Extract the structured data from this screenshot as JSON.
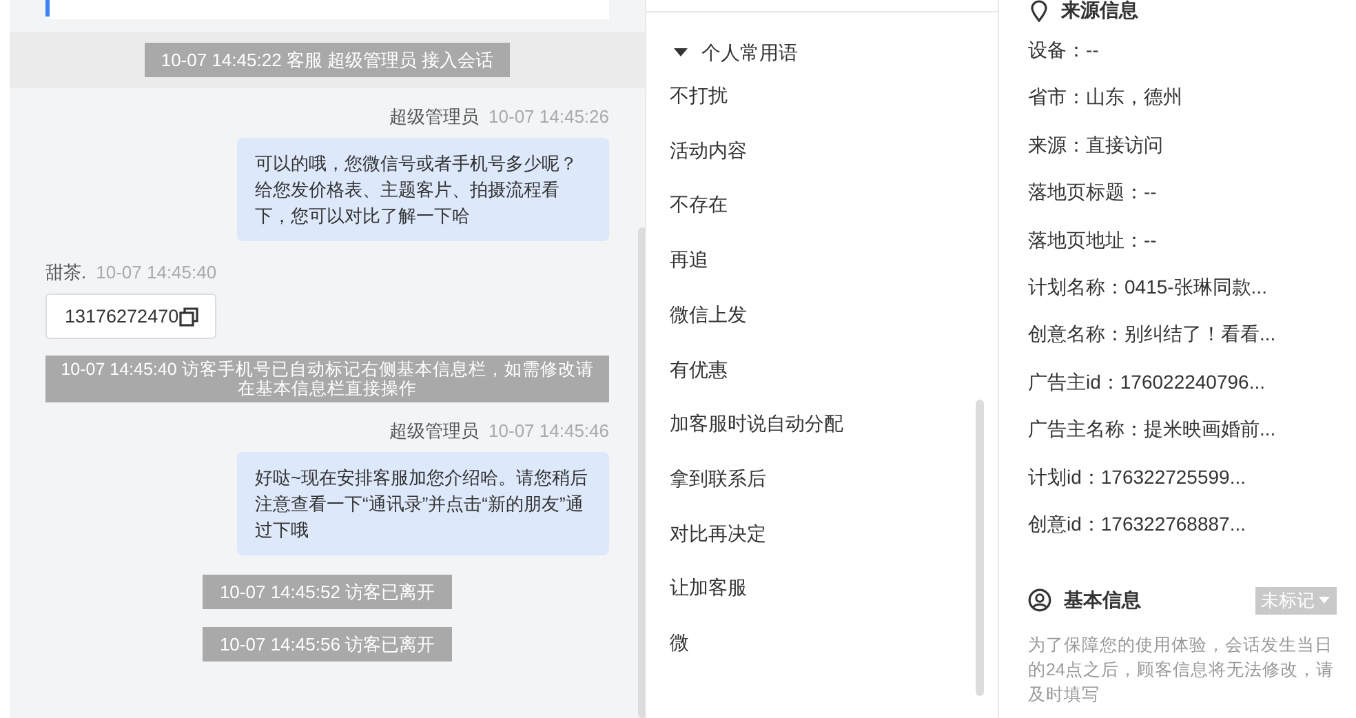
{
  "chat": {
    "messages": [
      {
        "kind": "system_band",
        "text": "10-07 14:45:22 客服 超级管理员 接入会话"
      },
      {
        "kind": "agent",
        "sender": "超级管理员",
        "time": "10-07 14:45:26",
        "text": "可以的哦，您微信号或者手机号多少呢？给您发价格表、主题客片、拍摄流程看下，您可以对比了解一下哈"
      },
      {
        "kind": "visitor",
        "sender": "甜茶.",
        "time": "10-07 14:45:40",
        "text": "13176272470"
      },
      {
        "kind": "system_wide",
        "text": "10-07 14:45:40 访客手机号已自动标记右侧基本信息栏，如需修改请在基本信息栏直接操作"
      },
      {
        "kind": "agent",
        "sender": "超级管理员",
        "time": "10-07 14:45:46",
        "text": "好哒~现在安排客服加您介绍哈。请您稍后注意查看一下“通讯录”并点击“新的朋友”通过下哦"
      },
      {
        "kind": "system",
        "text": "10-07 14:45:52 访客已离开"
      },
      {
        "kind": "system",
        "text": "10-07 14:45:56 访客已离开"
      }
    ]
  },
  "phrases": {
    "group": {
      "label": "个人常用语",
      "expanded": true
    },
    "items": [
      "不打扰",
      "活动内容",
      "不存在",
      "再追",
      "微信上发",
      "有优惠",
      "加客服时说自动分配",
      "拿到联系后",
      "对比再决定",
      "让加客服",
      "微"
    ]
  },
  "source_info": {
    "title": "来源信息",
    "fields": [
      "设备：--",
      "省市：山东，德州",
      "来源：直接访问",
      "落地页标题：--",
      "落地页地址：--",
      "计划名称：0415-张琳同款...",
      "创意名称：别纠结了！看看...",
      "广告主id：176022240796...",
      "广告主名称：提米映画婚前...",
      "计划id：176322725599...",
      "创意id：176322768887..."
    ]
  },
  "basic_info": {
    "title": "基本信息",
    "tag": "未标记",
    "note": "为了保障您的使用体验，会话发生当日的24点之后，顾客信息将无法修改，请及时填写"
  }
}
